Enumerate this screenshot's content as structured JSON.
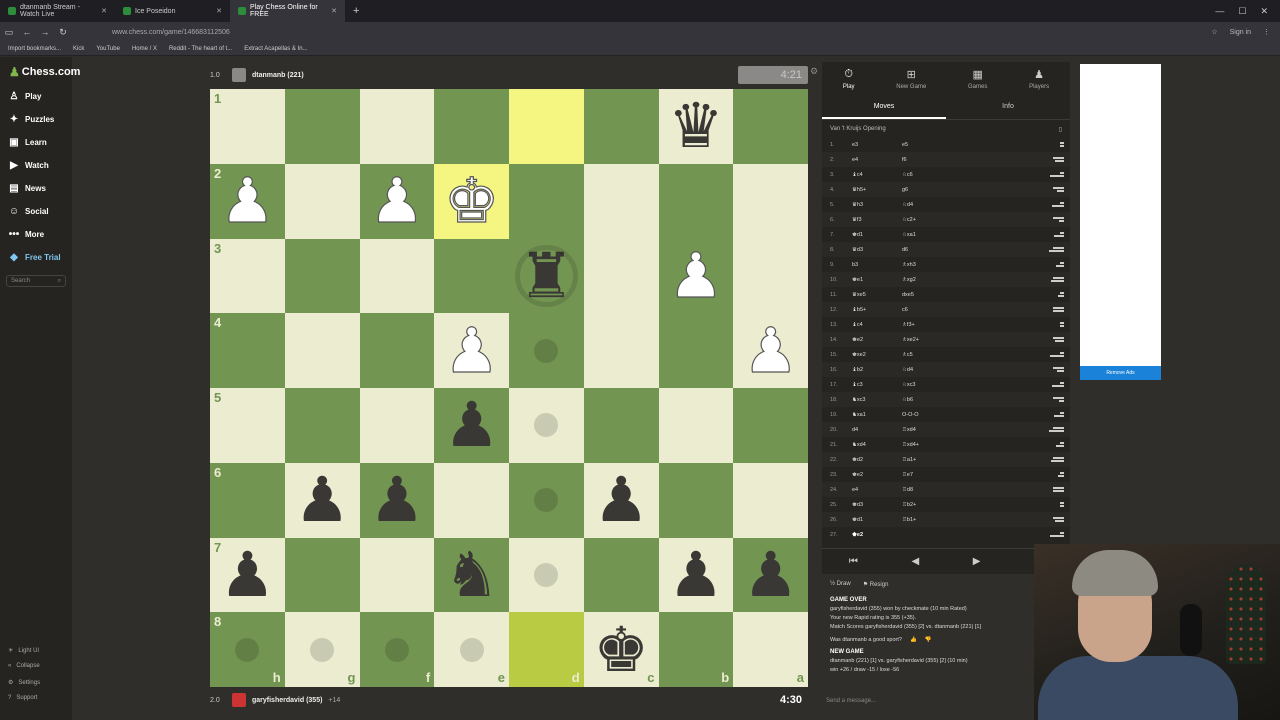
{
  "browser": {
    "tabs": [
      {
        "label": "dtanmanb Stream - Watch Live",
        "active": false
      },
      {
        "label": "Ice Poseidon",
        "active": false
      },
      {
        "label": "Play Chess Online for FREE",
        "active": true
      }
    ],
    "url": "www.chess.com/game/146683112506",
    "signin": "Sign in",
    "bookmarks": [
      "Import bookmarks...",
      "Kick",
      "YouTube",
      "Home / X",
      "Reddit - The heart of t...",
      "Extract Acapellas & In..."
    ]
  },
  "sidebar": {
    "logo": "Chess.com",
    "items": [
      {
        "label": "Play",
        "icon": "play-icon"
      },
      {
        "label": "Puzzles",
        "icon": "puzzle-icon"
      },
      {
        "label": "Learn",
        "icon": "learn-icon"
      },
      {
        "label": "Watch",
        "icon": "watch-icon"
      },
      {
        "label": "News",
        "icon": "news-icon"
      },
      {
        "label": "Social",
        "icon": "social-icon"
      },
      {
        "label": "More",
        "icon": "more-icon"
      },
      {
        "label": "Free Trial",
        "icon": "diamond-icon"
      }
    ],
    "search_placeholder": "Search",
    "bottom": [
      "Light UI",
      "Collapse",
      "Settings",
      "Support"
    ]
  },
  "top_player": {
    "badge": "1.0",
    "name": "dtanmanb (221)",
    "clock": "4:21"
  },
  "bottom_player": {
    "badge": "2.0",
    "name": "garyfisherdavid (355)",
    "material": "+14",
    "clock": "4:30"
  },
  "board": {
    "ranks": [
      "1",
      "2",
      "3",
      "4",
      "5",
      "6",
      "7",
      "8"
    ],
    "files": [
      "h",
      "g",
      "f",
      "e",
      "d",
      "c",
      "b",
      "a"
    ],
    "colors": {
      "light": "#ebecd0",
      "dark": "#739552",
      "highlight": "#f5f682"
    }
  },
  "panel": {
    "tabs": [
      {
        "label": "Play",
        "icon": "stopwatch-icon"
      },
      {
        "label": "New Game",
        "icon": "new-game-icon"
      },
      {
        "label": "Games",
        "icon": "grid-icon"
      },
      {
        "label": "Players",
        "icon": "players-icon"
      }
    ],
    "subtabs": [
      "Moves",
      "Info"
    ],
    "opening": "Van 't Kruijs Opening",
    "moves": [
      {
        "n": "1.",
        "w": "e3",
        "b": "e5"
      },
      {
        "n": "2.",
        "w": "e4",
        "b": "f6"
      },
      {
        "n": "3.",
        "w": "♝c4",
        "b": "♘c6"
      },
      {
        "n": "4.",
        "w": "♛h5+",
        "b": "g6"
      },
      {
        "n": "5.",
        "w": "♛h3",
        "b": "♘d4"
      },
      {
        "n": "6.",
        "w": "♛f3",
        "b": "♘c2+"
      },
      {
        "n": "7.",
        "w": "♚d1",
        "b": "♘xa1"
      },
      {
        "n": "8.",
        "w": "♛d3",
        "b": "d6"
      },
      {
        "n": "9.",
        "w": "b3",
        "b": "♗xh3"
      },
      {
        "n": "10.",
        "w": "♚e1",
        "b": "♗xg2"
      },
      {
        "n": "11.",
        "w": "♛xe5",
        "b": "dxe5"
      },
      {
        "n": "12.",
        "w": "♝b5+",
        "b": "c6"
      },
      {
        "n": "13.",
        "w": "♝c4",
        "b": "♗f3+"
      },
      {
        "n": "14.",
        "w": "♚e2",
        "b": "♗xe2+"
      },
      {
        "n": "15.",
        "w": "♚xe2",
        "b": "♗c5"
      },
      {
        "n": "16.",
        "w": "♝b2",
        "b": "♘d4"
      },
      {
        "n": "17.",
        "w": "♝c3",
        "b": "♘xc3"
      },
      {
        "n": "18.",
        "w": "♞xc3",
        "b": "♘b6"
      },
      {
        "n": "19.",
        "w": "♞xa1",
        "b": "O-O-O"
      },
      {
        "n": "20.",
        "w": "d4",
        "b": "♖xd4"
      },
      {
        "n": "21.",
        "w": "♞xd4",
        "b": "♖xd4+"
      },
      {
        "n": "22.",
        "w": "♚d2",
        "b": "♖a1+"
      },
      {
        "n": "23.",
        "w": "♚e2",
        "b": "♖e7"
      },
      {
        "n": "24.",
        "w": "e4",
        "b": "♖d8"
      },
      {
        "n": "25.",
        "w": "♚d3",
        "b": "♖b2+"
      },
      {
        "n": "26.",
        "w": "♚d1",
        "b": "♖b1+"
      },
      {
        "n": "27.",
        "w": "♚e2",
        "b": ""
      }
    ],
    "controls": [
      "⏮",
      "◀",
      "▶",
      "⏭"
    ],
    "draw": "Draw",
    "resign": "Resign",
    "game_over_title": "GAME OVER",
    "game_over_lines": [
      "garyfisherdavid (355) won by checkmate (10 min Rated)",
      "Your new Rapid rating is 355 (+35).",
      "Match Scores garyfisherdavid (355) [2] vs. dtanmanb (221) [1]"
    ],
    "good_sport": "Was dtanmanb a good sport?",
    "new_game_title": "NEW GAME",
    "new_game_lines": [
      "dtanmanb (221) [1] vs. garyfisherdavid (355) [2] (10 min)",
      "win +26 / draw -15 / lose -56"
    ],
    "chat_placeholder": "Send a message..."
  },
  "ad": {
    "button": "Remove Ads"
  }
}
